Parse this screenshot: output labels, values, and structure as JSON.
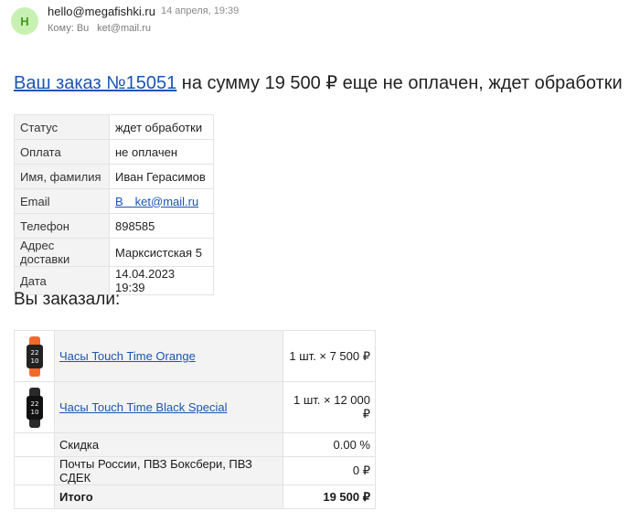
{
  "email": {
    "avatar_letter": "H",
    "from": "hello@megafishki.ru",
    "date": "14 апреля, 19:39",
    "to_label": "Кому:",
    "to_address": "Bu    ket@mail.ru"
  },
  "headline": {
    "link_text": "Ваш заказ №15051",
    "rest_text": " на сумму 19 500 ₽ еще не оплачен, ждет обработки"
  },
  "info": [
    {
      "label": "Статус",
      "value": "ждет обработки"
    },
    {
      "label": "Оплата",
      "value": "не оплачен"
    },
    {
      "label": "Имя, фамилия",
      "value": "Иван Герасимов"
    },
    {
      "label": "Email",
      "value": "B     ket@mail.ru"
    },
    {
      "label": "Телефон",
      "value": "898585"
    },
    {
      "label": "Адрес доставки",
      "value": "Марксистская 5"
    },
    {
      "label": "Дата",
      "value": "14.04.2023 19:39"
    }
  ],
  "ordered_title": "Вы заказали:",
  "items": [
    {
      "name": "Часы Touch Time Orange",
      "qty_price": "1 шт. × 7 500 ₽",
      "color": "#f06a2c",
      "screen_text": "22 10"
    },
    {
      "name": "Часы Touch Time Black Special",
      "qty_price": "1 шт. × 12 000 ₽",
      "color": "#2a2a2a",
      "screen_text": "22 10"
    }
  ],
  "summary": [
    {
      "label": "Скидка",
      "value": "0.00 %"
    },
    {
      "label": "Почты России, ПВЗ Боксбери, ПВЗ СДЕК",
      "value": "0 ₽"
    }
  ],
  "total": {
    "label": "Итого",
    "value": "19 500 ₽"
  }
}
